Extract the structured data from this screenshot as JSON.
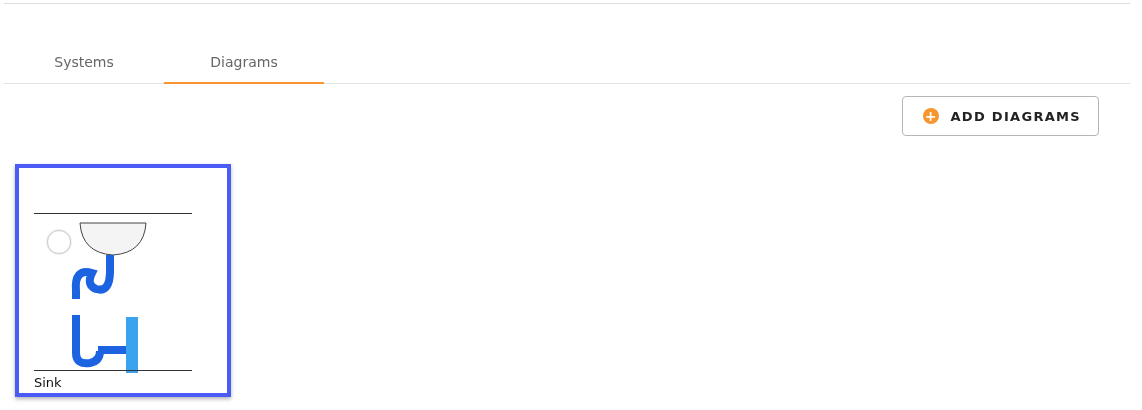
{
  "tabs": [
    {
      "label": "Systems",
      "selected": false
    },
    {
      "label": "Diagrams",
      "selected": true
    }
  ],
  "add_button": {
    "label": "ADD DIAGRAMS",
    "icon": "+"
  },
  "diagrams": [
    {
      "name": "Sink",
      "selected": true,
      "checked": false
    }
  ]
}
